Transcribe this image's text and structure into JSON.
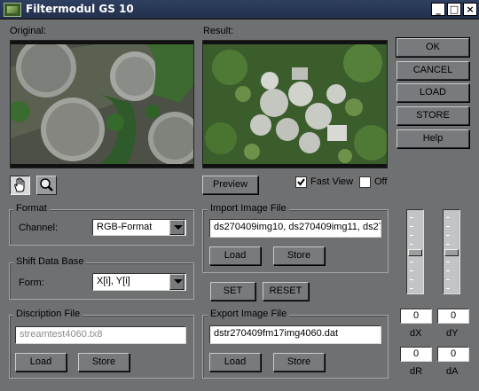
{
  "window": {
    "title": "Filtermodul GS 10",
    "minimize_label": "_",
    "maximize_label": "□",
    "close_label": "×"
  },
  "images": {
    "original_label": "Original:",
    "result_label": "Result:"
  },
  "tools": {
    "hand_icon": "hand-icon",
    "zoom_icon": "magnifier-icon"
  },
  "preview": {
    "preview_label": "Preview",
    "fast_view_label": "Fast View",
    "fast_view_checked": true,
    "off_label": "Off",
    "off_checked": false
  },
  "format": {
    "title": "Format",
    "channel_label": "Channel:",
    "channel_value": "RGB-Format"
  },
  "shift": {
    "title": "Shift Data Base",
    "form_label": "Form:",
    "form_value": "X[i], Y[i]"
  },
  "description": {
    "title": "Discription File",
    "file_value": "streamtest4060.tx8",
    "load_label": "Load",
    "store_label": "Store"
  },
  "import": {
    "title": "Import Image File",
    "file_value": "ds270409img10, ds270409img11, ds270",
    "load_label": "Load",
    "store_label": "Store"
  },
  "actions": {
    "set_label": "SET",
    "reset_label": "RESET"
  },
  "export": {
    "title": "Export Image File",
    "file_value": "dstr270409fm17img4060.dat",
    "load_label": "Load",
    "store_label": "Store"
  },
  "side_buttons": {
    "ok": "OK",
    "cancel": "CANCEL",
    "load": "LOAD",
    "store": "STORE",
    "help": "Help"
  },
  "offsets": {
    "dx_value": "0",
    "dy_value": "0",
    "dr_value": "0",
    "da_value": "0",
    "dx_label": "dX",
    "dy_label": "dY",
    "dr_label": "dR",
    "da_label": "dA"
  },
  "colors": {
    "window_bg": "#6f7072",
    "title_bar": "#2f3f5f"
  }
}
